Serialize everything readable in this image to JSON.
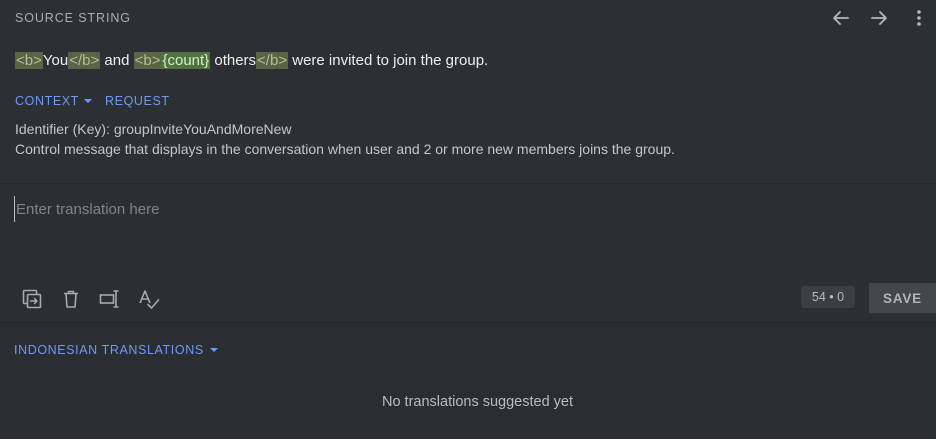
{
  "header": {
    "title": "SOURCE STRING"
  },
  "icons": {
    "prev": "arrow-left-icon",
    "next": "arrow-right-icon",
    "more": "more-vertical-icon"
  },
  "source": {
    "segments": [
      {
        "type": "tag",
        "text": "<b>"
      },
      {
        "type": "text",
        "text": "You"
      },
      {
        "type": "tag",
        "text": "</b>"
      },
      {
        "type": "text",
        "text": " and "
      },
      {
        "type": "tag",
        "text": "<b>"
      },
      {
        "type": "placeholder",
        "text": "{count}"
      },
      {
        "type": "text",
        "text": " others"
      },
      {
        "type": "tag",
        "text": "</b>"
      },
      {
        "type": "text",
        "text": " were invited to join the group."
      }
    ]
  },
  "context": {
    "tab_label": "CONTEXT",
    "request_label": "REQUEST",
    "identifier": "Identifier (Key): groupInviteYouAndMoreNew",
    "description": "Control message that displays in the conversation when user and 2 or more new members joins the group."
  },
  "editor": {
    "placeholder": "Enter translation here",
    "value": "",
    "counter": "54 • 0",
    "save_label": "SAVE",
    "tools": [
      "copy-source-icon",
      "delete-icon",
      "text-cursor-icon",
      "spellcheck-icon"
    ]
  },
  "translations": {
    "language_label": "INDONESIAN TRANSLATIONS",
    "empty_message": "No translations suggested yet"
  },
  "colors": {
    "accent": "#6e9af5",
    "background": "#2b2e33",
    "tag_bg": "#5a6347",
    "placeholder_bg": "#4f7246"
  }
}
